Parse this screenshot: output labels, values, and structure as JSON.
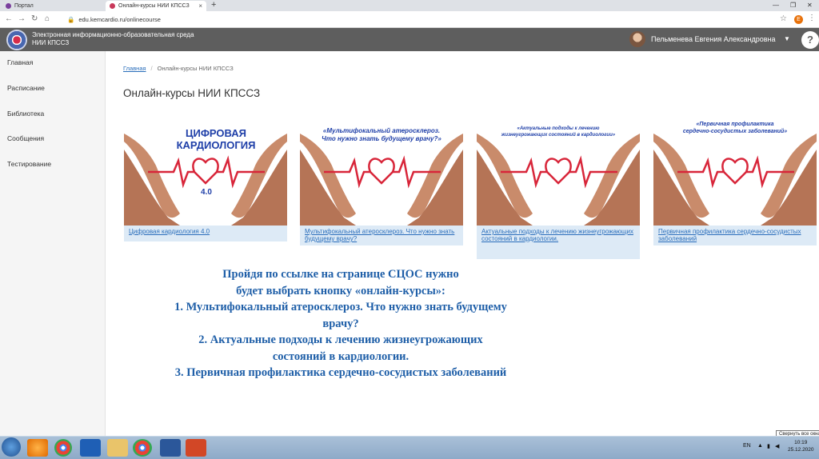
{
  "browser": {
    "tabs": [
      {
        "title": "Портал"
      },
      {
        "title": "Онлайн-курсы НИИ КПССЗ",
        "close": "×"
      }
    ],
    "new_tab": "+",
    "url": "edu.kemcardio.ru/onlinecourse",
    "profile_letter": "Е"
  },
  "header": {
    "title_line1": "Электронная информационно-образовательная среда",
    "title_line2": "НИИ КПССЗ",
    "user_name": "Пельменева Евгения Александровна",
    "help": "?"
  },
  "sidebar": {
    "items": [
      {
        "label": "Главная"
      },
      {
        "label": "Расписание"
      },
      {
        "label": "Библиотека"
      },
      {
        "label": "Сообщения"
      },
      {
        "label": "Тестирование"
      }
    ]
  },
  "breadcrumb": {
    "home": "Главная",
    "separator": "/",
    "current": "Онлайн-курсы НИИ КПССЗ"
  },
  "page_title": "Онлайн-курсы НИИ КПССЗ",
  "courses": [
    {
      "caption": "Цифровая кардиология 4.0",
      "image_title_1": "ЦИФРОВАЯ",
      "image_title_2": "КАРДИОЛОГИЯ",
      "image_sub": "4.0"
    },
    {
      "caption": "Мультифокальный атеросклероз. Что нужно знать будущему врачу?",
      "image_title_1": "«Мультифокальный атеросклероз.",
      "image_title_2": "Что нужно знать будущему врачу?»"
    },
    {
      "caption": "Актуальные подходы к лечению жизнеугрожающих состояний в кардиологии.",
      "image_title_1": "«Актуальные подходы к лечению",
      "image_title_2": "жизнеугрожающих состояний в кардиологии»"
    },
    {
      "caption": "Первичная профилактика сердечно-сосудистых заболеваний",
      "image_title_1": "«Первичная профилактика",
      "image_title_2": "сердечно-сосудистых заболеваний»"
    }
  ],
  "instructions": [
    "Пройдя по ссылке на странице СЦОС нужно",
    "будет выбрать кнопку «онлайн-курсы»:",
    "1. Мультифокальный атеросклероз. Что нужно знать будущему",
    "врачу?",
    "2. Актуальные подходы к лечению жизнеугрожающих",
    "состояний в кардиологии.",
    "3. Первичная профилактика сердечно-сосудистых заболеваний"
  ],
  "taskbar": {
    "language": "EN",
    "time": "10:19",
    "date": "25.12.2020",
    "tooltip": "Свернуть все окна"
  },
  "colors": {
    "header_bg": "#5e5e5e",
    "link": "#2a6ebb",
    "caption_bg": "#ddeaf6",
    "instruction_text": "#1f5fa8",
    "ecg_red": "#d8263a"
  }
}
